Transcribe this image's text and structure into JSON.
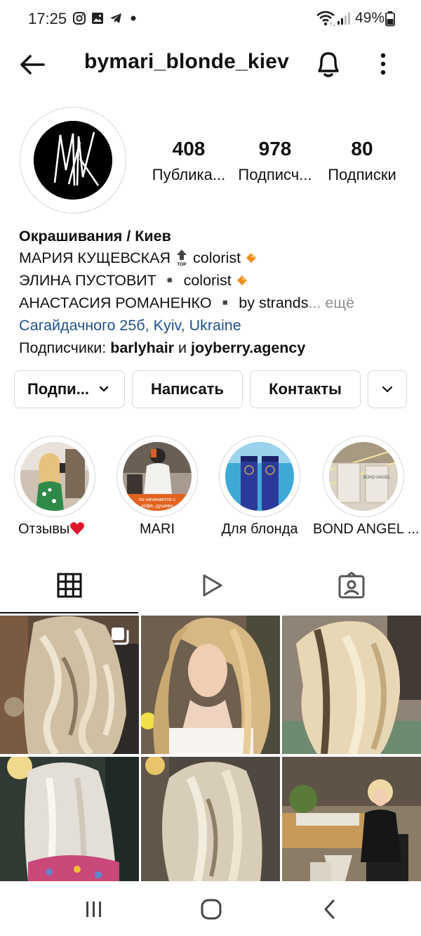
{
  "status_bar": {
    "time": "17:25",
    "battery": "49%",
    "icons": [
      "instagram-icon",
      "gallery-icon",
      "telegram-icon",
      "dot-icon",
      "wifi-icon",
      "signal-icon",
      "battery-icon"
    ]
  },
  "header": {
    "username": "bymari_blonde_kiev"
  },
  "stats": [
    {
      "value": "408",
      "label": "Публика..."
    },
    {
      "value": "978",
      "label": "Подписч..."
    },
    {
      "value": "80",
      "label": "Подписки"
    }
  ],
  "bio": {
    "category": "Окрашивания / Киев",
    "line1": "МАРИЯ КУЩЕВСКАЯ",
    "line1_tail": "colorist",
    "line2": "ЭЛИНА ПУСТОВИТ ▪️ colorist",
    "line3": "АНАСТАСИЯ РОМАНЕНКО ▪️ by strands",
    "line3_more": "... ещё",
    "location": "Сагайдачного 25б, Kyiv, Ukraine",
    "followers_prefix": "Подписчики: ",
    "follower1": "barlyhair",
    "followers_and": " и ",
    "follower2": "joyberry.agency"
  },
  "buttons": {
    "following": "Подпи...",
    "message": "Написать",
    "contacts": "Контакты"
  },
  "highlights": [
    {
      "label": "Отзывы"
    },
    {
      "label": "MARI"
    },
    {
      "label": "Для блонда"
    },
    {
      "label": "BOND ANGEL ..."
    }
  ],
  "colors": {
    "link": "#1d4f91",
    "muted": "#8e8e8e",
    "heart": "#e0162b"
  }
}
